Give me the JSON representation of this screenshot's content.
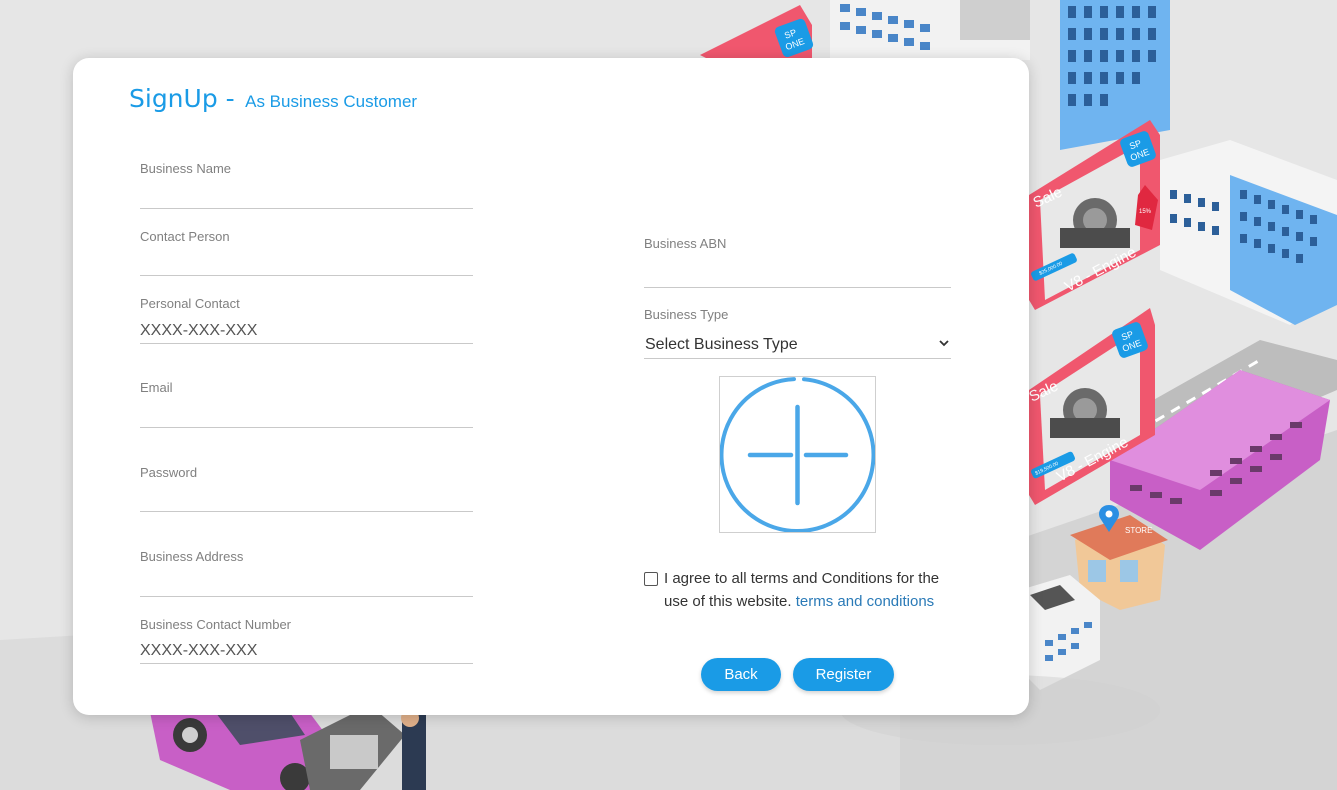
{
  "heading": {
    "main": "SignUp -",
    "sub": "As Business Customer"
  },
  "fields": {
    "business_name": {
      "label": "Business Name",
      "placeholder": ""
    },
    "contact_person": {
      "label": "Contact Person",
      "placeholder": ""
    },
    "personal_contact": {
      "label": "Personal Contact",
      "placeholder": "XXXX-XXX-XXX"
    },
    "email": {
      "label": "Email",
      "placeholder": ""
    },
    "password": {
      "label": "Password",
      "placeholder": ""
    },
    "business_address": {
      "label": "Business Address",
      "placeholder": ""
    },
    "business_contact_number": {
      "label": "Business Contact Number",
      "placeholder": "XXXX-XXX-XXX"
    },
    "business_abn": {
      "label": "Business ABN",
      "placeholder": ""
    }
  },
  "business_type": {
    "label": "Business Type",
    "selected": "Select Business Type"
  },
  "upload": {
    "icon": "add-image-icon",
    "color": "#4aa7e8"
  },
  "terms": {
    "text": "I agree to all terms and Conditions for the use of this website.",
    "link": "terms and conditions",
    "checked": false
  },
  "buttons": {
    "back": "Back",
    "register": "Register"
  },
  "background": {
    "signs": [
      {
        "brand_line1": "SP",
        "brand_line2": "ONE",
        "sale": "Sale",
        "product": "V8 - Engine",
        "price": "$25,000.00",
        "tag": "15%"
      },
      {
        "brand_line1": "SP",
        "brand_line2": "ONE",
        "sale": "Sale",
        "product": "V8 - Engine",
        "price": "$19,500.00"
      },
      {
        "brand_line1": "SP",
        "brand_line2": "ONE"
      }
    ],
    "store_sign": "STORE"
  },
  "colors": {
    "accent": "#1a9be6",
    "link": "#2a7ab7",
    "sign": "#f0576e",
    "brand_badge": "#1a9be6",
    "building_blue": "#6fb4f0",
    "building_purple": "#c85fc6"
  }
}
